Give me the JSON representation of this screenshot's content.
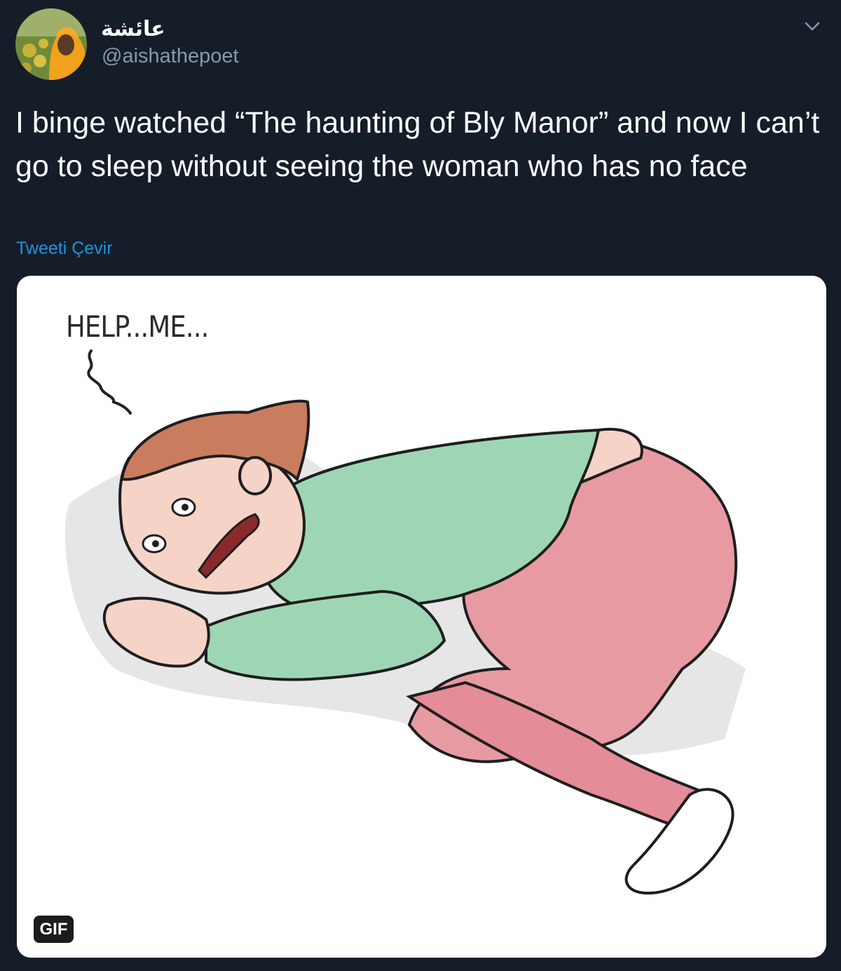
{
  "tweet": {
    "author": {
      "display_name": "عائشة",
      "handle": "@aishathepoet"
    },
    "text": "I binge watched “The haunting of Bly Manor” and now I can’t go to sleep without seeing the woman who has no face",
    "translate_label": "Tweeti Çevir"
  },
  "media": {
    "caption_text": "HELP...ME...",
    "badge": "GIF"
  },
  "icons": {
    "more_menu": "chevron-down-icon"
  },
  "colors": {
    "background": "#151d28",
    "link": "#1b95e0",
    "secondary_text": "#8899a6"
  }
}
